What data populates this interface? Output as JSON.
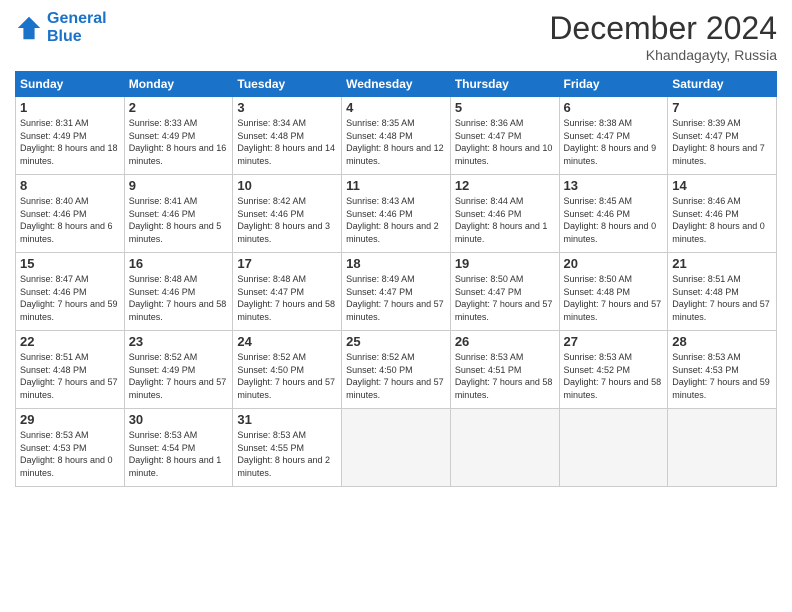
{
  "header": {
    "logo_line1": "General",
    "logo_line2": "Blue",
    "month": "December 2024",
    "location": "Khandagayty, Russia"
  },
  "days_of_week": [
    "Sunday",
    "Monday",
    "Tuesday",
    "Wednesday",
    "Thursday",
    "Friday",
    "Saturday"
  ],
  "weeks": [
    [
      {
        "day": "1",
        "rise": "8:31 AM",
        "set": "4:49 PM",
        "daylight": "8 hours and 18 minutes"
      },
      {
        "day": "2",
        "rise": "8:33 AM",
        "set": "4:49 PM",
        "daylight": "8 hours and 16 minutes"
      },
      {
        "day": "3",
        "rise": "8:34 AM",
        "set": "4:48 PM",
        "daylight": "8 hours and 14 minutes"
      },
      {
        "day": "4",
        "rise": "8:35 AM",
        "set": "4:48 PM",
        "daylight": "8 hours and 12 minutes"
      },
      {
        "day": "5",
        "rise": "8:36 AM",
        "set": "4:47 PM",
        "daylight": "8 hours and 10 minutes"
      },
      {
        "day": "6",
        "rise": "8:38 AM",
        "set": "4:47 PM",
        "daylight": "8 hours and 9 minutes"
      },
      {
        "day": "7",
        "rise": "8:39 AM",
        "set": "4:47 PM",
        "daylight": "8 hours and 7 minutes"
      }
    ],
    [
      {
        "day": "8",
        "rise": "8:40 AM",
        "set": "4:46 PM",
        "daylight": "8 hours and 6 minutes"
      },
      {
        "day": "9",
        "rise": "8:41 AM",
        "set": "4:46 PM",
        "daylight": "8 hours and 5 minutes"
      },
      {
        "day": "10",
        "rise": "8:42 AM",
        "set": "4:46 PM",
        "daylight": "8 hours and 3 minutes"
      },
      {
        "day": "11",
        "rise": "8:43 AM",
        "set": "4:46 PM",
        "daylight": "8 hours and 2 minutes"
      },
      {
        "day": "12",
        "rise": "8:44 AM",
        "set": "4:46 PM",
        "daylight": "8 hours and 1 minute"
      },
      {
        "day": "13",
        "rise": "8:45 AM",
        "set": "4:46 PM",
        "daylight": "8 hours and 0 minutes"
      },
      {
        "day": "14",
        "rise": "8:46 AM",
        "set": "4:46 PM",
        "daylight": "8 hours and 0 minutes"
      }
    ],
    [
      {
        "day": "15",
        "rise": "8:47 AM",
        "set": "4:46 PM",
        "daylight": "7 hours and 59 minutes"
      },
      {
        "day": "16",
        "rise": "8:48 AM",
        "set": "4:46 PM",
        "daylight": "7 hours and 58 minutes"
      },
      {
        "day": "17",
        "rise": "8:48 AM",
        "set": "4:47 PM",
        "daylight": "7 hours and 58 minutes"
      },
      {
        "day": "18",
        "rise": "8:49 AM",
        "set": "4:47 PM",
        "daylight": "7 hours and 57 minutes"
      },
      {
        "day": "19",
        "rise": "8:50 AM",
        "set": "4:47 PM",
        "daylight": "7 hours and 57 minutes"
      },
      {
        "day": "20",
        "rise": "8:50 AM",
        "set": "4:48 PM",
        "daylight": "7 hours and 57 minutes"
      },
      {
        "day": "21",
        "rise": "8:51 AM",
        "set": "4:48 PM",
        "daylight": "7 hours and 57 minutes"
      }
    ],
    [
      {
        "day": "22",
        "rise": "8:51 AM",
        "set": "4:48 PM",
        "daylight": "7 hours and 57 minutes"
      },
      {
        "day": "23",
        "rise": "8:52 AM",
        "set": "4:49 PM",
        "daylight": "7 hours and 57 minutes"
      },
      {
        "day": "24",
        "rise": "8:52 AM",
        "set": "4:50 PM",
        "daylight": "7 hours and 57 minutes"
      },
      {
        "day": "25",
        "rise": "8:52 AM",
        "set": "4:50 PM",
        "daylight": "7 hours and 57 minutes"
      },
      {
        "day": "26",
        "rise": "8:53 AM",
        "set": "4:51 PM",
        "daylight": "7 hours and 58 minutes"
      },
      {
        "day": "27",
        "rise": "8:53 AM",
        "set": "4:52 PM",
        "daylight": "7 hours and 58 minutes"
      },
      {
        "day": "28",
        "rise": "8:53 AM",
        "set": "4:53 PM",
        "daylight": "7 hours and 59 minutes"
      }
    ],
    [
      {
        "day": "29",
        "rise": "8:53 AM",
        "set": "4:53 PM",
        "daylight": "8 hours and 0 minutes"
      },
      {
        "day": "30",
        "rise": "8:53 AM",
        "set": "4:54 PM",
        "daylight": "8 hours and 1 minute"
      },
      {
        "day": "31",
        "rise": "8:53 AM",
        "set": "4:55 PM",
        "daylight": "8 hours and 2 minutes"
      },
      null,
      null,
      null,
      null
    ]
  ]
}
